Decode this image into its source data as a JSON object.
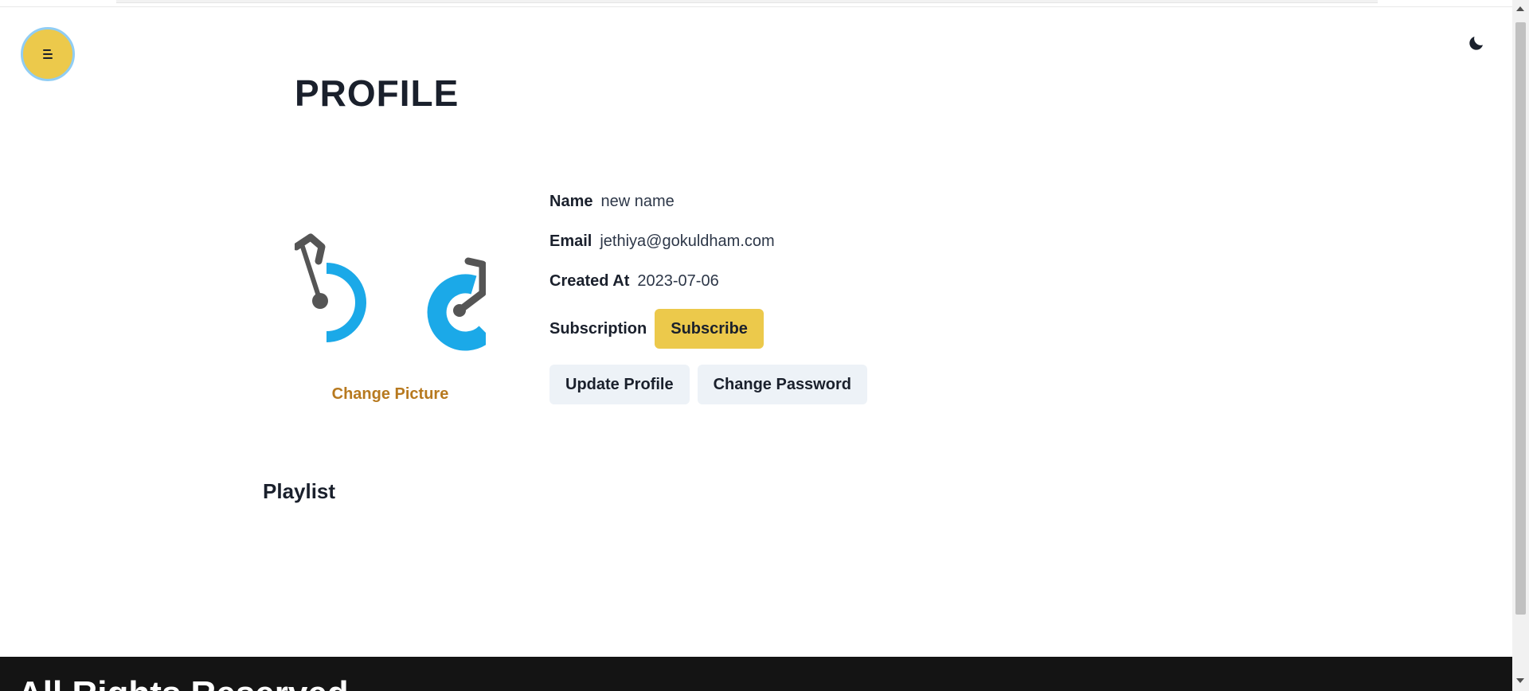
{
  "header": {
    "menu_icon": "hamburger-icon",
    "theme_icon": "moon-icon"
  },
  "profile": {
    "title": "PROFILE",
    "change_picture_label": "Change Picture",
    "name_label": "Name",
    "name_value": "new name",
    "email_label": "Email",
    "email_value": "jethiya@gokuldham.com",
    "created_label": "Created At",
    "created_value": "2023-07-06",
    "subscription_label": "Subscription",
    "subscribe_button": "Subscribe",
    "update_profile_button": "Update Profile",
    "change_password_button": "Change Password"
  },
  "playlist": {
    "heading": "Playlist"
  },
  "footer": {
    "text": "All Rights Reserved"
  },
  "colors": {
    "accent_yellow": "#ecc94b",
    "avatar_blue": "#1ba9e8",
    "avatar_gray": "#555555",
    "link_brown": "#b7791f",
    "footer_bg": "#141414"
  }
}
